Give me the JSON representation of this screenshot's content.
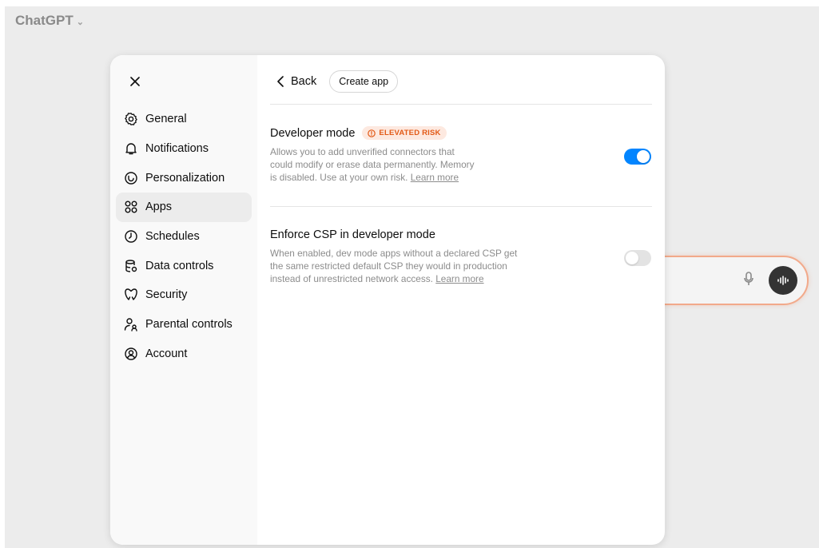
{
  "app": {
    "title": "ChatGPT"
  },
  "colors": {
    "accent": "#0285ff",
    "risk": "#e25a17",
    "composer_border": "#f2a98a"
  },
  "sidebar": {
    "items": [
      {
        "label": "General",
        "icon": "gear-icon",
        "active": false
      },
      {
        "label": "Notifications",
        "icon": "bell-icon",
        "active": false
      },
      {
        "label": "Personalization",
        "icon": "personalization-icon",
        "active": false
      },
      {
        "label": "Apps",
        "icon": "apps-grid-icon",
        "active": true
      },
      {
        "label": "Schedules",
        "icon": "clock-icon",
        "active": false
      },
      {
        "label": "Data controls",
        "icon": "database-icon",
        "active": false
      },
      {
        "label": "Security",
        "icon": "shield-icon",
        "active": false
      },
      {
        "label": "Parental controls",
        "icon": "parental-icon",
        "active": false
      },
      {
        "label": "Account",
        "icon": "account-icon",
        "active": false
      }
    ]
  },
  "header": {
    "back_label": "Back",
    "create_label": "Create app"
  },
  "settings": [
    {
      "title": "Developer mode",
      "badge": "ELEVATED RISK",
      "desc_lines": [
        "Allows you to add unverified connectors that",
        "could modify or erase data permanently. Memory",
        "is disabled. Use at your own risk."
      ],
      "link": "Learn more",
      "enabled": true
    },
    {
      "title": "Enforce CSP in developer mode",
      "badge": "",
      "desc_lines": [
        "When enabled, dev mode apps without a declared CSP get",
        "the same restricted default CSP they would in production",
        "instead of unrestricted network access."
      ],
      "link": "Learn more",
      "enabled": false
    }
  ]
}
